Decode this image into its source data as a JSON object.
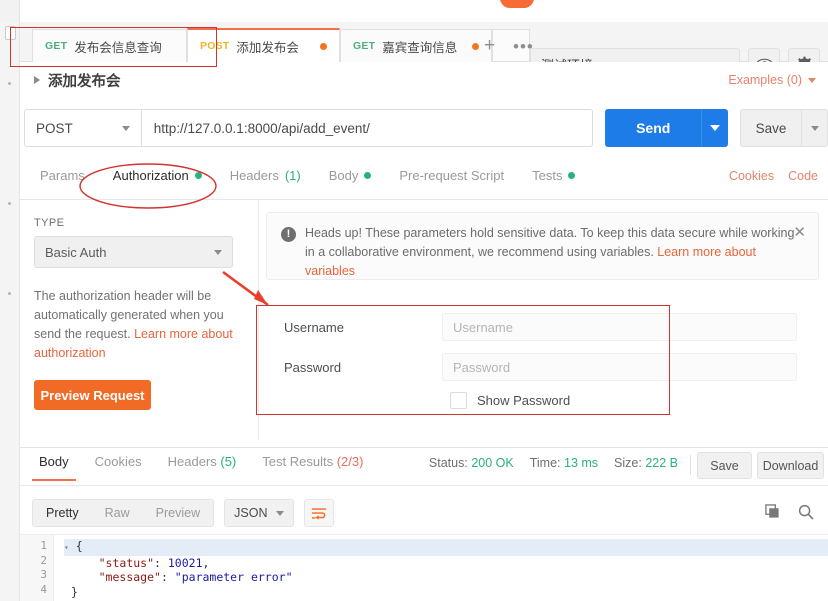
{
  "tabs": [
    {
      "method": "GET",
      "method_class": "get",
      "label": "发布会信息查询",
      "unsaved": false,
      "active": false
    },
    {
      "method": "POST",
      "method_class": "post",
      "label": "添加发布会",
      "unsaved": true,
      "active": true
    },
    {
      "method": "GET",
      "method_class": "get",
      "label": "嘉宾查询信息",
      "unsaved": true,
      "active": false
    }
  ],
  "tabbar": {
    "add_tab_label": "+",
    "more_label": "•••"
  },
  "environment": {
    "selected": "测试环境",
    "eye_icon": "eye-icon",
    "gear_icon": "gear-icon"
  },
  "request": {
    "title": "添加发布会",
    "examples_label": "Examples (0)",
    "method": "POST",
    "url": "http://127.0.0.1:8000/api/add_event/",
    "send_label": "Send",
    "save_label": "Save"
  },
  "request_tabs": [
    {
      "label": "Params",
      "active": false,
      "dot": false,
      "count": ""
    },
    {
      "label": "Authorization",
      "active": true,
      "dot": true,
      "count": ""
    },
    {
      "label": "Headers",
      "active": false,
      "dot": false,
      "count": "(1)"
    },
    {
      "label": "Body",
      "active": false,
      "dot": true,
      "count": ""
    },
    {
      "label": "Pre-request Script",
      "active": false,
      "dot": false,
      "count": ""
    },
    {
      "label": "Tests",
      "active": false,
      "dot": true,
      "count": ""
    }
  ],
  "request_links": {
    "cookies": "Cookies",
    "code": "Code"
  },
  "auth": {
    "type_label": "TYPE",
    "type_value": "Basic Auth",
    "description_1": "The authorization header will be automatically generated when you send the request. ",
    "description_link": "Learn more about authorization",
    "preview_label": "Preview Request"
  },
  "banner": {
    "icon": "exclamation-icon",
    "text": "Heads up! These parameters hold sensitive data. To keep this data secure while working in a collaborative environment, we recommend using variables. ",
    "link": "Learn more about variables",
    "close_icon": "close-icon"
  },
  "credentials": {
    "username_label": "Username",
    "username_value": "",
    "username_placeholder": "Username",
    "password_label": "Password",
    "password_value": "",
    "password_placeholder": "Password",
    "show_password_label": "Show Password",
    "show_password_checked": false
  },
  "response_tabs": [
    {
      "label": "Body",
      "active": true,
      "count": "",
      "count_color": ""
    },
    {
      "label": "Cookies",
      "active": false,
      "count": "",
      "count_color": ""
    },
    {
      "label": "Headers",
      "active": false,
      "count": "(5)",
      "count_color": "green"
    },
    {
      "label": "Test Results",
      "active": false,
      "count": "(2/3)",
      "count_color": "red"
    }
  ],
  "response_meta": {
    "status_label": "Status:",
    "status_value": "200 OK",
    "time_label": "Time:",
    "time_value": "13 ms",
    "size_label": "Size:",
    "size_value": "222 B",
    "save_label": "Save",
    "download_label": "Download"
  },
  "body_toolbar": {
    "formats": [
      {
        "label": "Pretty",
        "active": true
      },
      {
        "label": "Raw",
        "active": false
      },
      {
        "label": "Preview",
        "active": false
      }
    ],
    "language": "JSON",
    "wrap_icon": "word-wrap-icon",
    "copy_icon": "copy-icon",
    "search_icon": "search-icon"
  },
  "response_body": {
    "line_numbers": [
      "1",
      "2",
      "3",
      "4"
    ],
    "lines": [
      {
        "text": "{",
        "kind": "brace"
      },
      {
        "key": "\"status\"",
        "sep": ": ",
        "value": "10021",
        "value_kind": "num",
        "trail": ","
      },
      {
        "key": "\"message\"",
        "sep": ": ",
        "value": "\"parameter error\"",
        "value_kind": "str",
        "trail": ""
      },
      {
        "text": "}",
        "kind": "brace"
      }
    ]
  },
  "annotations": {
    "ellipse_target": "Authorization",
    "arrow_from": "type-select",
    "arrow_to": "credentials-panel",
    "highlight_color": "#d2332e"
  },
  "colors": {
    "accent_orange": "#f2704e",
    "send_blue": "#1e7ce8",
    "success_green": "#2ab27b",
    "link_orange": "#e8643c",
    "annotation_red": "#d2332e"
  }
}
